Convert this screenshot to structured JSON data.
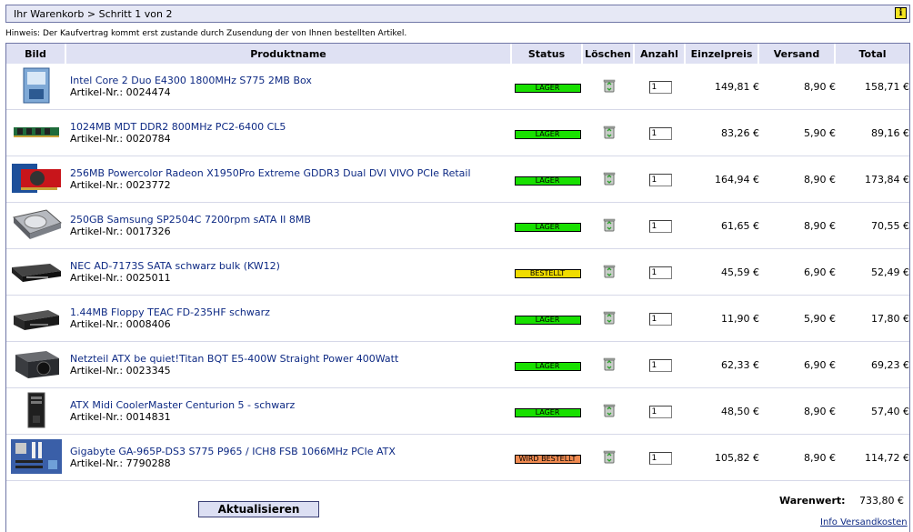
{
  "breadcrumb": "Ihr Warenkorb > Schritt 1 von 2",
  "hint": "Hinweis: Der Kaufvertrag kommt erst zustande durch Zusendung der von Ihnen bestellten Artikel.",
  "columns": {
    "bild": "Bild",
    "produktname": "Produktname",
    "status": "Status",
    "loeschen": "Löschen",
    "anzahl": "Anzahl",
    "einzelpreis": "Einzelpreis",
    "versand": "Versand",
    "total": "Total"
  },
  "status_colors": {
    "LAGER": "#18e000",
    "BESTELLT": "#f0dc00",
    "WIRD BESTELLT": "#f08a50"
  },
  "items": [
    {
      "name": "Intel Core 2 Duo E4300 1800MHz S775 2MB Box",
      "artno": "Artikel-Nr.: 0024474",
      "status": "LAGER",
      "qty": "1",
      "unit_price": "149,81 €",
      "shipping": "8,90 €",
      "total": "158,71 €",
      "image": "cpu-box-image"
    },
    {
      "name": "1024MB MDT DDR2 800MHz PC2-6400 CL5",
      "artno": "Artikel-Nr.: 0020784",
      "status": "LAGER",
      "qty": "1",
      "unit_price": "83,26 €",
      "shipping": "5,90 €",
      "total": "89,16 €",
      "image": "ram-module-image"
    },
    {
      "name": "256MB Powercolor Radeon X1950Pro Extreme GDDR3 Dual DVI VIVO PCIe Retail",
      "artno": "Artikel-Nr.: 0023772",
      "status": "LAGER",
      "qty": "1",
      "unit_price": "164,94 €",
      "shipping": "8,90 €",
      "total": "173,84 €",
      "image": "graphics-card-image"
    },
    {
      "name": "250GB Samsung SP2504C 7200rpm sATA II 8MB",
      "artno": "Artikel-Nr.: 0017326",
      "status": "LAGER",
      "qty": "1",
      "unit_price": "61,65 €",
      "shipping": "8,90 €",
      "total": "70,55 €",
      "image": "hard-disk-image"
    },
    {
      "name": "NEC AD-7173S SATA schwarz bulk (KW12)",
      "artno": "Artikel-Nr.: 0025011",
      "status": "BESTELLT",
      "qty": "1",
      "unit_price": "45,59 €",
      "shipping": "6,90 €",
      "total": "52,49 €",
      "image": "optical-drive-image"
    },
    {
      "name": "1.44MB Floppy TEAC FD-235HF schwarz",
      "artno": "Artikel-Nr.: 0008406",
      "status": "LAGER",
      "qty": "1",
      "unit_price": "11,90 €",
      "shipping": "5,90 €",
      "total": "17,80 €",
      "image": "floppy-drive-image"
    },
    {
      "name": "Netzteil ATX be quiet!Titan BQT E5-400W Straight Power 400Watt",
      "artno": "Artikel-Nr.: 0023345",
      "status": "LAGER",
      "qty": "1",
      "unit_price": "62,33 €",
      "shipping": "6,90 €",
      "total": "69,23 €",
      "image": "power-supply-image"
    },
    {
      "name": "ATX Midi CoolerMaster Centurion 5 - schwarz",
      "artno": "Artikel-Nr.: 0014831",
      "status": "LAGER",
      "qty": "1",
      "unit_price": "48,50 €",
      "shipping": "8,90 €",
      "total": "57,40 €",
      "image": "pc-case-image"
    },
    {
      "name": "Gigabyte GA-965P-DS3 S775 P965 / ICH8 FSB 1066MHz PCIe ATX",
      "artno": "Artikel-Nr.: 7790288",
      "status": "WIRD BESTELLT",
      "qty": "1",
      "unit_price": "105,82 €",
      "shipping": "8,90 €",
      "total": "114,72 €",
      "image": "mainboard-image"
    }
  ],
  "update_button": "Aktualisieren",
  "summary": {
    "label": "Warenwert:",
    "value": "733,80 €"
  },
  "shipping_link": "Info Versandkosten",
  "icons": {
    "info": "info-icon",
    "delete": "trash-icon"
  }
}
